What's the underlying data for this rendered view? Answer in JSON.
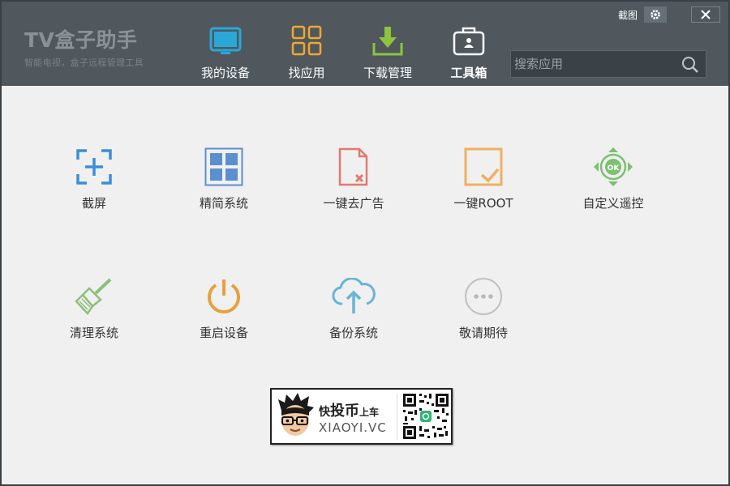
{
  "app": {
    "title": "TV盒子助手",
    "subtitle": "智能电视，盒子远程管理工具"
  },
  "topbar": {
    "screenshot_label": "截图"
  },
  "nav": {
    "items": [
      {
        "label": "我的设备",
        "icon": "tv-icon",
        "color": "#29a8d8"
      },
      {
        "label": "找应用",
        "icon": "apps-grid-icon",
        "color": "#f0a830"
      },
      {
        "label": "下载管理",
        "icon": "download-icon",
        "color": "#8cc43c"
      },
      {
        "label": "工具箱",
        "icon": "toolbox-icon",
        "color": "#ffffff",
        "active": true
      }
    ]
  },
  "search": {
    "placeholder": "搜索应用"
  },
  "tools": [
    {
      "label": "截屏",
      "icon": "screenshot-icon",
      "color": "#3a8fd6"
    },
    {
      "label": "精简系统",
      "icon": "grid-icon",
      "color": "#5b8fd0"
    },
    {
      "label": "一键去广告",
      "icon": "remove-ad-icon",
      "color": "#e07a70"
    },
    {
      "label": "一键ROOT",
      "icon": "root-check-icon",
      "color": "#f0b060"
    },
    {
      "label": "自定义遥控",
      "icon": "remote-dpad-icon",
      "color": "#7cc070"
    },
    {
      "label": "清理系统",
      "icon": "broom-icon",
      "color": "#8cc07a"
    },
    {
      "label": "重启设备",
      "icon": "power-icon",
      "color": "#e8a040"
    },
    {
      "label": "备份系统",
      "icon": "cloud-upload-icon",
      "color": "#68b4d8"
    },
    {
      "label": "敬请期待",
      "icon": "more-icon",
      "color": "#b8b8b8"
    }
  ],
  "promo": {
    "prefix": "快",
    "highlight": "投币",
    "suffix": "上车",
    "site": "XIAOYI.VC"
  }
}
